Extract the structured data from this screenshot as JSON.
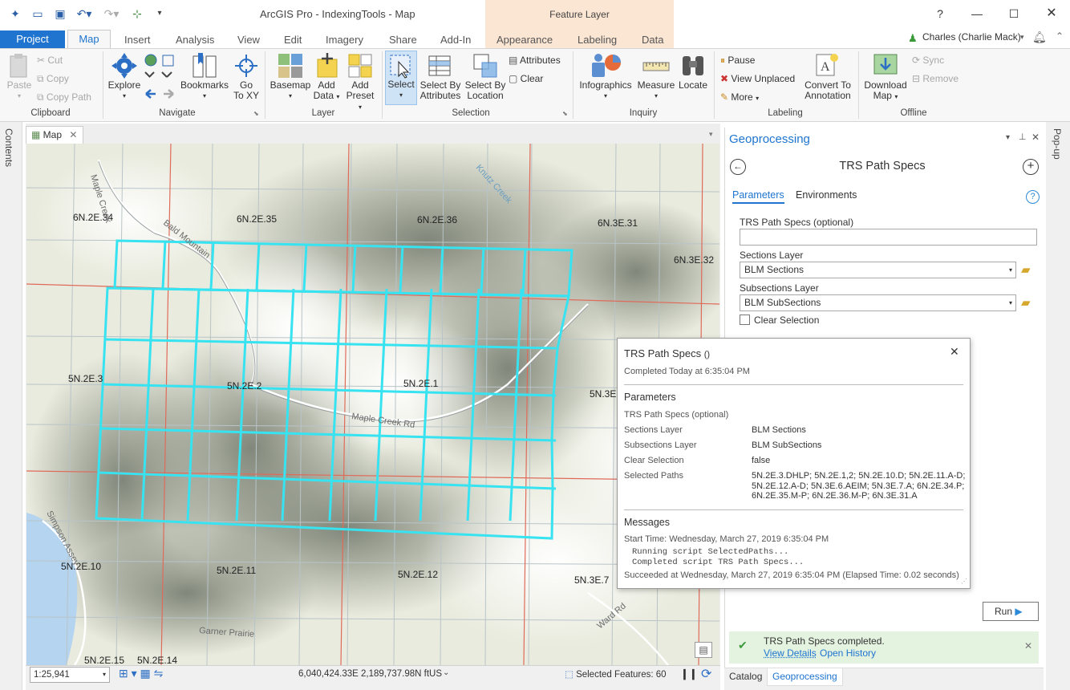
{
  "title_bar": {
    "app_title": "ArcGIS Pro - IndexingTools - Map",
    "context_group": "Feature Layer",
    "help": "?"
  },
  "tabs": {
    "project": "Project",
    "items": [
      "Map",
      "Insert",
      "Analysis",
      "View",
      "Edit",
      "Imagery",
      "Share",
      "Add-In",
      "Appearance",
      "Labeling",
      "Data"
    ]
  },
  "user": {
    "name": "Charles (Charlie Mack)"
  },
  "ribbon": {
    "clipboard": {
      "paste": "Paste",
      "cut": "Cut",
      "copy": "Copy",
      "copy_path": "Copy Path",
      "group": "Clipboard"
    },
    "navigate": {
      "explore": "Explore",
      "bookmarks": "Bookmarks",
      "go_to_xy_1": "Go",
      "go_to_xy_2": "To XY",
      "group": "Navigate"
    },
    "layer": {
      "basemap": "Basemap",
      "add_data_1": "Add",
      "add_data_2": "Data",
      "add_preset_1": "Add",
      "add_preset_2": "Preset",
      "group": "Layer"
    },
    "selection": {
      "select": "Select",
      "select_by_attr_1": "Select By",
      "select_by_attr_2": "Attributes",
      "select_by_loc_1": "Select By",
      "select_by_loc_2": "Location",
      "attributes": "Attributes",
      "clear": "Clear",
      "group": "Selection"
    },
    "inquiry": {
      "infographics": "Infographics",
      "measure": "Measure",
      "locate": "Locate",
      "group": "Inquiry"
    },
    "labeling": {
      "pause": "Pause",
      "view_unplaced": "View Unplaced",
      "more": "More",
      "convert_1": "Convert To",
      "convert_2": "Annotation",
      "group": "Labeling"
    },
    "offline": {
      "download_1": "Download",
      "download_2": "Map",
      "sync": "Sync",
      "remove": "Remove",
      "group": "Offline"
    }
  },
  "panes": {
    "contents": "Contents",
    "map_tab": "Map",
    "popup": "Pop-up"
  },
  "map": {
    "labels": [
      "6N.2E.34",
      "6N.2E.35",
      "6N.2E.36",
      "6N.3E.31",
      "6N.3E.32",
      "5N.2E.3",
      "5N.2E.2",
      "5N.2E.1",
      "5N.3E",
      "5N.2E.10",
      "5N.2E.11",
      "5N.2E.12",
      "5N.3E.7",
      "5N.2E.15",
      "5N.2E.14"
    ],
    "road_labels": [
      "Maple Creek",
      "Bald Mountain",
      "Knutz Creek",
      "Maple Creek Rd",
      "Simpson Assey",
      "Garner Prairie",
      "Ward Rd"
    ],
    "highlight_color": "#37e3f0"
  },
  "status_bar": {
    "scale": "1:25,941",
    "coordinates": "6,040,424.33E 2,189,737.98N ftUS",
    "selected_features": "Selected Features: 60"
  },
  "geoprocessing": {
    "pane_title": "Geoprocessing",
    "tool_title": "TRS Path Specs",
    "tab_parameters": "Parameters",
    "tab_environments": "Environments",
    "trs_label": "TRS Path Specs (optional)",
    "trs_value": "",
    "sections_label": "Sections Layer",
    "sections_value": "BLM Sections",
    "subsections_label": "Subsections Layer",
    "subsections_value": "BLM SubSections",
    "clear_selection": "Clear Selection",
    "run": "Run",
    "completed_message": "TRS Path Specs completed.",
    "view_details": "View Details",
    "open_history": "Open History",
    "bottom_tab_catalog": "Catalog",
    "bottom_tab_geoprocessing": "Geoprocessing"
  },
  "result": {
    "title": "TRS Path Specs",
    "title_suffix": "()",
    "completed": "Completed Today at 6:35:04 PM",
    "parameters_header": "Parameters",
    "params": [
      {
        "name": "TRS Path Specs (optional)",
        "value": ""
      },
      {
        "name": "Sections Layer",
        "value": "BLM Sections"
      },
      {
        "name": "Subsections Layer",
        "value": "BLM SubSections"
      },
      {
        "name": "Clear Selection",
        "value": "false"
      },
      {
        "name": "Selected Paths",
        "value_lines": [
          "5N.2E.3.DHLP; 5N.2E.1,2; 5N.2E.10.D; 5N.2E.11.A-D;",
          "5N.2E.12.A-D; 5N.3E.6.AEIM; 5N.3E.7.A; 6N.2E.34.P;",
          "6N.2E.35.M-P; 6N.2E.36.M-P; 6N.3E.31.A"
        ]
      }
    ],
    "messages_header": "Messages",
    "start_time": "Start Time: Wednesday, March 27, 2019 6:35:04 PM",
    "msg1": "Running script SelectedPaths...",
    "msg2": "Completed script TRS Path Specs...",
    "succeeded": "Succeeded at Wednesday, March 27, 2019 6:35:04 PM (Elapsed Time: 0.02 seconds)"
  }
}
